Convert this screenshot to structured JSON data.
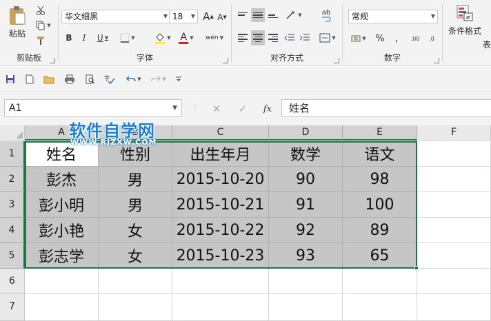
{
  "ribbon": {
    "clipboard": {
      "group_label": "剪贴板",
      "paste_label": "粘贴"
    },
    "font": {
      "group_label": "字体",
      "font_name": "华文细黑",
      "font_size": "18",
      "bold": "B",
      "italic": "I",
      "underline": "U",
      "grow": "A",
      "shrink": "A",
      "font_color_glyph": "A",
      "phonetic": "wén"
    },
    "alignment": {
      "group_label": "对齐方式",
      "wrap_label": "ab"
    },
    "number": {
      "group_label": "数字",
      "format": "常规",
      "percent": "%",
      "comma": ",",
      "inc_decimal": ".00",
      "dec_decimal": ".0"
    },
    "styles": {
      "conditional_label": "条件格式",
      "table_label": "表"
    }
  },
  "formula_bar": {
    "name_box": "A1",
    "fx": "fx",
    "content": "姓名"
  },
  "grid": {
    "columns": [
      "A",
      "B",
      "C",
      "D",
      "E",
      "F"
    ],
    "rows": [
      "1",
      "2",
      "3",
      "4",
      "5",
      "6",
      "7"
    ],
    "data": [
      [
        "姓名",
        "性别",
        "出生年月",
        "数学",
        "语文"
      ],
      [
        "彭杰",
        "男",
        "2015-10-20",
        "90",
        "98"
      ],
      [
        "彭小明",
        "男",
        "2015-10-21",
        "91",
        "100"
      ],
      [
        "彭小艳",
        "女",
        "2015-10-22",
        "92",
        "89"
      ],
      [
        "彭志学",
        "女",
        "2015-10-23",
        "93",
        "65"
      ]
    ]
  },
  "watermark": {
    "title": "软件自学网",
    "url": "WWW.RJZXW.COM"
  },
  "colors": {
    "accent": "#217346",
    "selection_fill": "#c6c6c6",
    "watermark_blue": "#1e7fd0"
  }
}
